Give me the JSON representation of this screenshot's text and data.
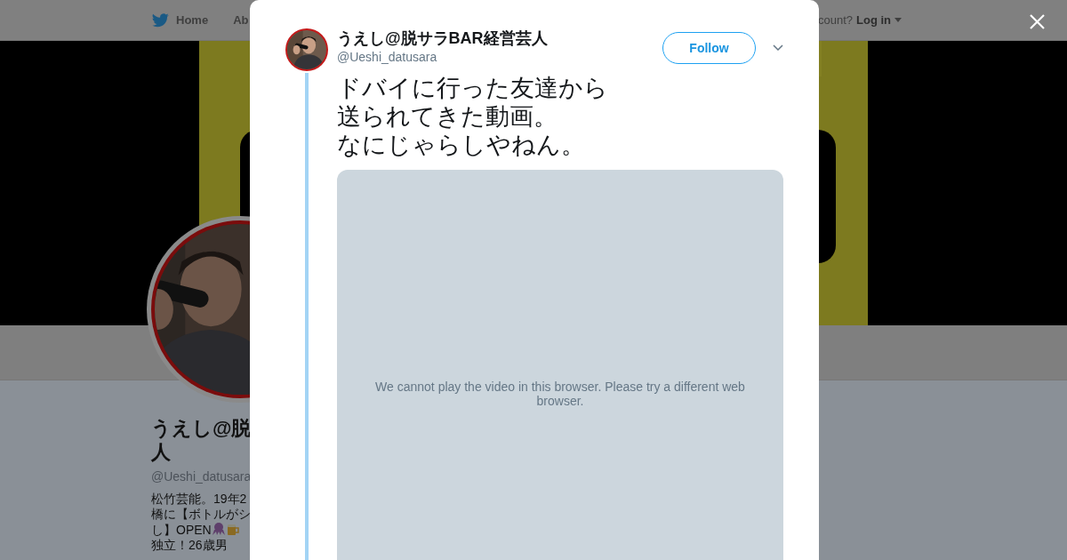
{
  "nav": {
    "items": [
      {
        "label": "Home",
        "kind": "home"
      },
      {
        "label": "Ab",
        "kind": "plain"
      }
    ],
    "account_prompt": "count?",
    "login": "Log in"
  },
  "profile": {
    "name_lines": [
      "うえし@脱",
      "人"
    ],
    "handle": "@Ueshi_datusara",
    "bio_lines": [
      "松竹芸能。19年2",
      "橋に【ボトルがシ",
      "し】OPEN",
      "独立！26歳男"
    ]
  },
  "modal": {
    "author": {
      "name": "うえし@脱サラBAR経営芸人",
      "handle": "@Ueshi_datusara"
    },
    "follow_button": "Follow",
    "tweet_lines": [
      "ドバイに行った友達から",
      "送られてきた動画。",
      "なにじゃらしやねん。"
    ],
    "video_message": "We cannot play the video in this browser. Please try a different web browser."
  }
}
